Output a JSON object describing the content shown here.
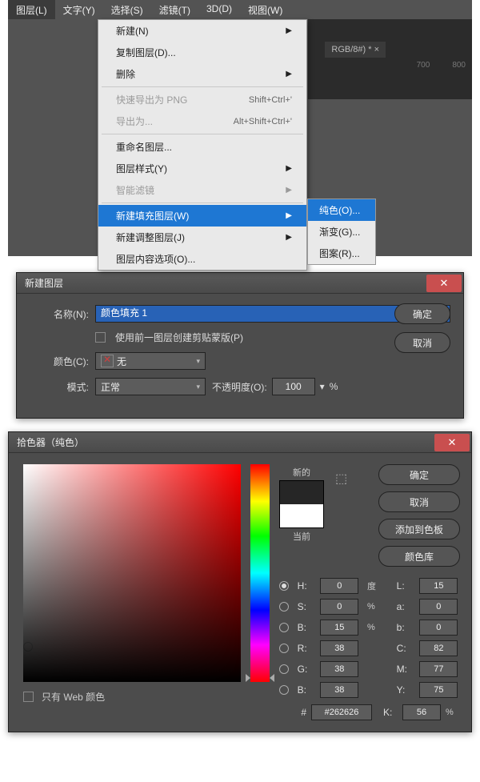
{
  "menubar": {
    "items": [
      "图层(L)",
      "文字(Y)",
      "选择(S)",
      "滤镜(T)",
      "3D(D)",
      "视图(W)"
    ],
    "active_index": 0
  },
  "dropdown": {
    "new": "新建(N)",
    "duplicate": "复制图层(D)...",
    "delete": "删除",
    "quick_export": "快速导出为 PNG",
    "quick_export_kbd": "Shift+Ctrl+'",
    "export_as": "导出为...",
    "export_as_kbd": "Alt+Shift+Ctrl+'",
    "rename": "重命名图层...",
    "layer_style": "图层样式(Y)",
    "smart_filter": "智能滤镜",
    "new_fill": "新建填充图层(W)",
    "new_adjust": "新建调整图层(J)",
    "layer_content": "图层内容选项(O)..."
  },
  "submenu": {
    "solid": "纯色(O)...",
    "gradient": "渐变(G)...",
    "pattern": "图案(R)..."
  },
  "doc_tab": "RGB/8#) * ×",
  "ruler": {
    "a": "700",
    "b": "800"
  },
  "new_layer": {
    "title": "新建图层",
    "name_label": "名称(N):",
    "name_value": "颜色填充 1",
    "use_prev_clip": "使用前一图层创建剪贴蒙版(P)",
    "color_label": "颜色(C):",
    "color_value": "无",
    "mode_label": "模式:",
    "mode_value": "正常",
    "opacity_label": "不透明度(O):",
    "opacity_value": "100",
    "opacity_unit": "%",
    "ok": "确定",
    "cancel": "取消"
  },
  "picker": {
    "title": "拾色器（纯色）",
    "new_label": "新的",
    "current_label": "当前",
    "ok": "确定",
    "cancel": "取消",
    "add_swatch": "添加到色板",
    "color_lib": "颜色库",
    "modes": {
      "H": {
        "label": "H:",
        "value": "0",
        "unit": "度"
      },
      "S": {
        "label": "S:",
        "value": "0",
        "unit": "%"
      },
      "Bv": {
        "label": "B:",
        "value": "15",
        "unit": "%"
      },
      "R": {
        "label": "R:",
        "value": "38",
        "unit": ""
      },
      "G": {
        "label": "G:",
        "value": "38",
        "unit": ""
      },
      "Bc": {
        "label": "B:",
        "value": "38",
        "unit": ""
      },
      "L": {
        "label": "L:",
        "value": "15",
        "unit": ""
      },
      "a": {
        "label": "a:",
        "value": "0",
        "unit": ""
      },
      "b": {
        "label": "b:",
        "value": "0",
        "unit": ""
      },
      "C": {
        "label": "C:",
        "value": "82",
        "unit": "%"
      },
      "M": {
        "label": "M:",
        "value": "77",
        "unit": "%"
      },
      "Y": {
        "label": "Y:",
        "value": "75",
        "unit": "%"
      },
      "K": {
        "label": "K:",
        "value": "56",
        "unit": "%"
      }
    },
    "hex_label": "#",
    "hex_value": "#262626",
    "web_only": "只有 Web 颜色"
  }
}
